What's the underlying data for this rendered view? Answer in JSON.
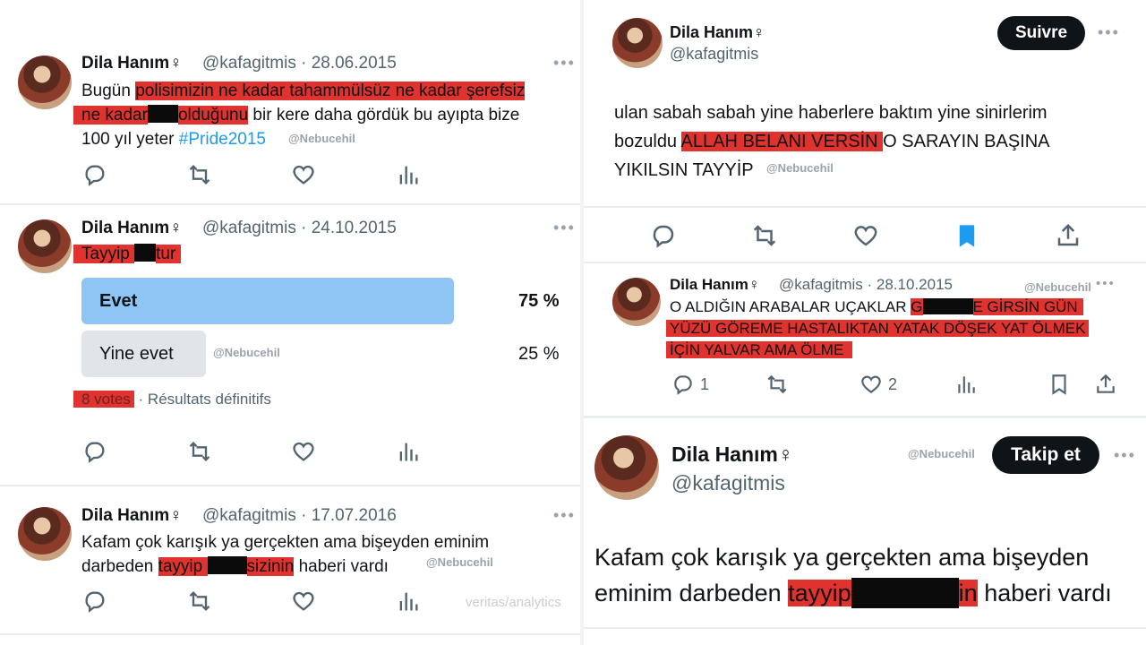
{
  "tweet1": {
    "name": "Dila Hanım♀",
    "handle_date": "@kafagitmis · 28.06.2015",
    "line1_a": "Bugün ",
    "line1_hl": "polisimizin ne kadar tahammülsüz ne kadar şerefsiz",
    "line2_hl1": "ne kadar",
    "line2_hl2": "olduğunu",
    "line2_b": " bir kere daha gördük bu ayıpta bize",
    "line3_a": "100 yıl yeter ",
    "line3_tag": "#Pride2015",
    "watermark": "@Nebucehil"
  },
  "tweet2": {
    "name": "Dila Hanım♀",
    "handle_date": "@kafagitmis · 24.10.2015",
    "text_a": "Tayyip ",
    "text_b": "tur",
    "poll": {
      "option1": "Evet",
      "pct1": "75 %",
      "option2": "Yine evet",
      "pct2": "25 %",
      "votes": "8 votes",
      "status": "Résultats définitifs",
      "fill1": 0.75,
      "fill2": 0.25
    },
    "watermark": "@Nebucehil"
  },
  "tweet3": {
    "name": "Dila Hanım♀",
    "handle_date": "@kafagitmis · 17.07.2016",
    "line1": "Kafam çok karışık ya gerçekten ama bişeyden eminim",
    "line2_a": "darbeden ",
    "line2_hl1": "tayyip ",
    "line2_hl2": "sizinin",
    "line2_b": " haberi vardı",
    "watermark": "@Nebucehil",
    "veritas": "veritas/analytics"
  },
  "tweet4": {
    "name": "Dila Hanım♀",
    "handle": "@kafagitmis",
    "follow_label": "Suivre",
    "line1": "ulan sabah sabah yine haberlere baktım yine sinirlerim",
    "line2_a": "bozuldu ",
    "line2_hl": "ALLAH BELANI VERSİN ",
    "line2_b": "O SARAYIN BAŞINA",
    "line3": "YIKILSIN TAYYİP",
    "watermark": "@Nebucehil"
  },
  "tweet5": {
    "name": "Dila Hanım♀",
    "handle_date": "@kafagitmis · 28.10.2015",
    "watermark": "@Nebucehil",
    "line1_a": "O ALDIĞIN ARABALAR UÇAKLAR ",
    "line1_hl1": "G",
    "line1_hl2": "E GİRSİN GÜN",
    "line2_hl": "YÜZÜ GÖREME HASTALIKTAN YATAK DÖŞEK YAT ÖLMEK",
    "line3_hl": "İÇİN YALVAR AMA ÖLME",
    "reply_count": "1",
    "like_count": "2"
  },
  "tweet6": {
    "name": "Dila Hanım♀",
    "handle": "@kafagitmis",
    "watermark": "@Nebucehil",
    "follow_label": "Takip et",
    "line1": "Kafam çok karışık ya gerçekten ama bişeyden",
    "line2_a": "eminim darbeden ",
    "line2_hl1": "tayyip",
    "line2_hl2": "in",
    "line2_b": " haberi vardı"
  },
  "colors": {
    "highlight": "#e0322e",
    "redaction": "#0b0b0b",
    "poll_winner": "#8ec5f4",
    "poll_other": "#e1e4e8",
    "link": "#1d9bf0",
    "bookmark_active": "#1d9bf0"
  }
}
